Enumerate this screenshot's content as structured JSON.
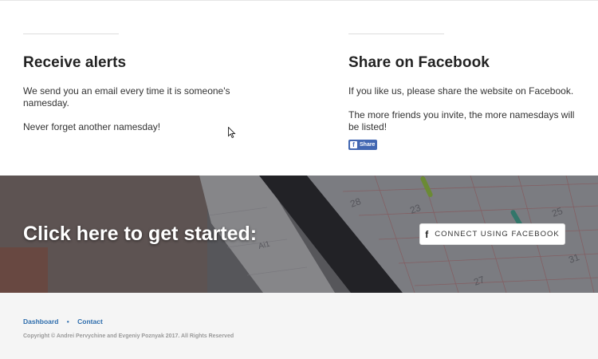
{
  "features": {
    "alerts": {
      "title": "Receive alerts",
      "paragraph1": "We send you an email every time it is someone's namesday.",
      "paragraph2": "Never forget another namesday!"
    },
    "facebook": {
      "title": "Share on Facebook",
      "paragraph1": "If you like us, please share the website on Facebook.",
      "paragraph2": "The more friends you invite, the more namesdays will be listed!",
      "share_button_label": "Share",
      "share_icon": "facebook-icon"
    }
  },
  "hero": {
    "heading": "Click here to get started:",
    "cta_label": "CONNECT USING FACEBOOK",
    "cta_icon": "facebook-f-icon",
    "calendar_numbers": [
      "28",
      "23",
      "Ai1",
      "27",
      "25",
      "31",
      "1"
    ]
  },
  "footer": {
    "links": [
      {
        "label": "Dashboard"
      },
      {
        "label": "Contact"
      }
    ],
    "separator": "•",
    "copyright": "Copyright © Andrei Pervychine and Evgeniy Poznyak 2017. All Rights Reserved"
  },
  "colors": {
    "facebook_blue": "#4267b2",
    "link_blue": "#2f6ead",
    "footer_bg": "#f5f5f5"
  }
}
